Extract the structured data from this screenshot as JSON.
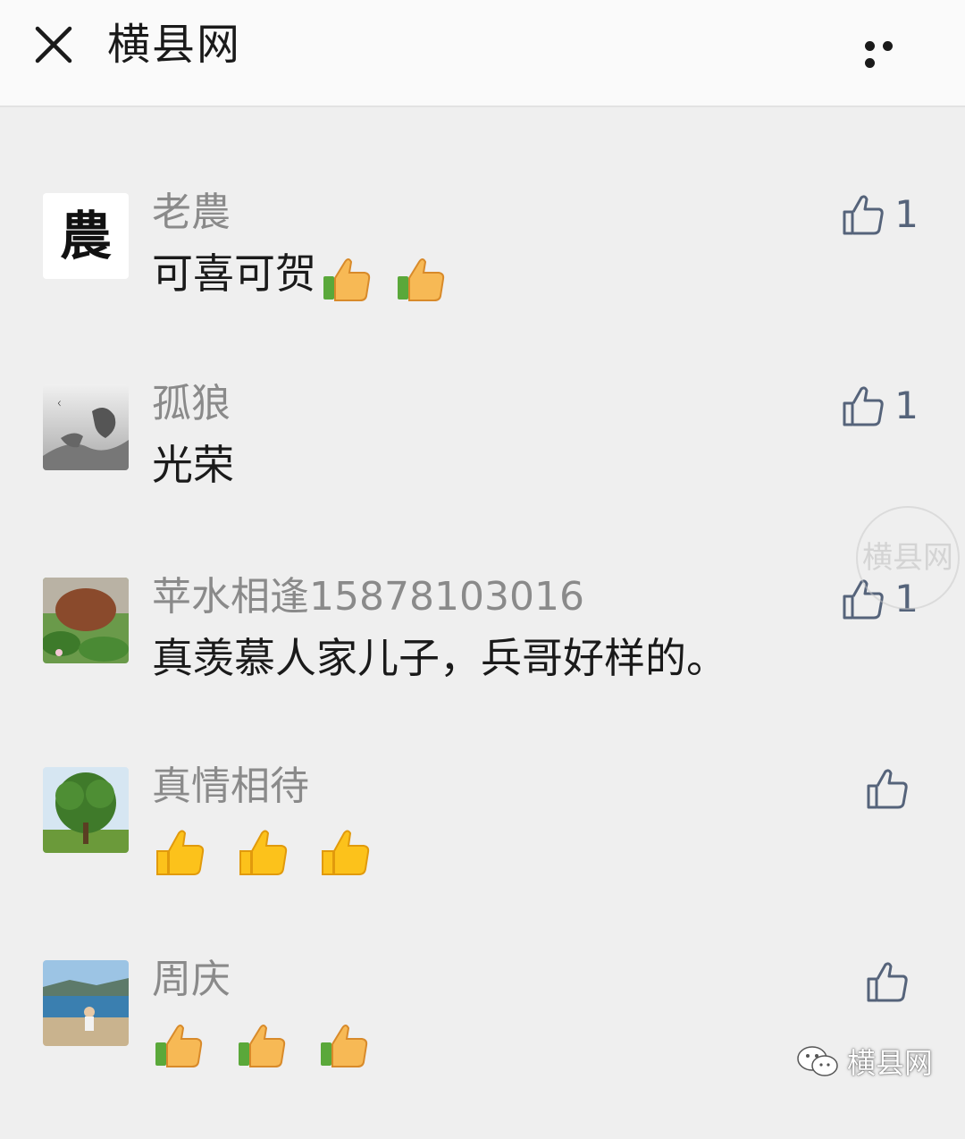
{
  "header": {
    "title": "横县网",
    "close_icon": "close-icon",
    "more_icon": "more-dots-icon"
  },
  "comments": [
    {
      "name": "老農",
      "text": "可喜可贺",
      "emoji_count": 2,
      "likes": "1",
      "avatar_text": "農"
    },
    {
      "name": "孤狼",
      "text": "光荣",
      "emoji_count": 0,
      "likes": "1",
      "avatar_text": ""
    },
    {
      "name": "苹水相逢15878103016",
      "text": "真羡慕人家儿子，兵哥好样的。",
      "emoji_count": 0,
      "likes": "1"
    },
    {
      "name": "真情相待",
      "text": "",
      "emoji_count": 3,
      "likes": ""
    },
    {
      "name": "周庆",
      "text": "",
      "emoji_count": 3,
      "likes": ""
    }
  ],
  "watermark": {
    "text": "横县网"
  },
  "footer": {
    "brand": "横县网"
  },
  "colors": {
    "background": "#efefef",
    "name": "#8a8a8a",
    "text": "#1a1a1a",
    "like_icon": "#55637a"
  }
}
